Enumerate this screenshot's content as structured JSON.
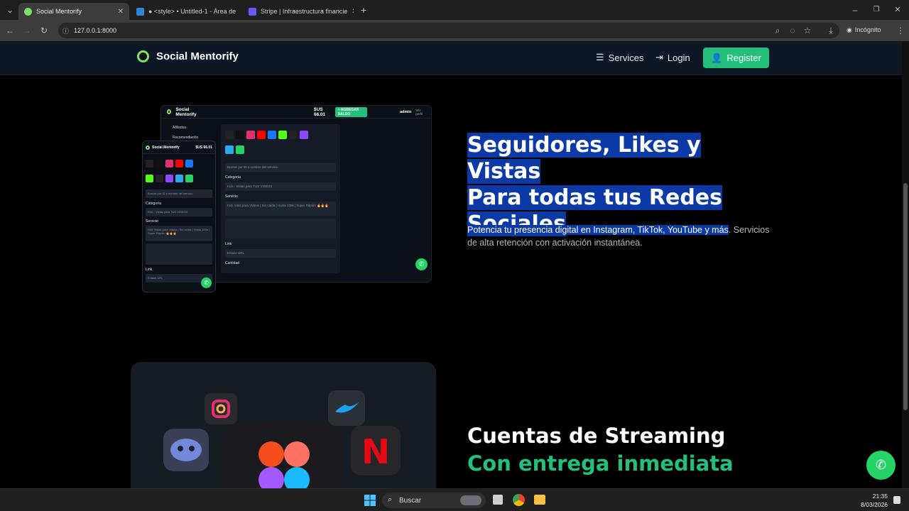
{
  "browser": {
    "tabs": [
      {
        "label": "Social Mentorify",
        "active": true
      },
      {
        "label": "● <style> • Untitled-1 - Área de",
        "active": false
      },
      {
        "label": "Stripe | Infraestructura financie",
        "active": false
      }
    ],
    "url": "127.0.0.1:8000",
    "incognito_label": "Incógnito"
  },
  "header": {
    "brand": "Social Mentorify",
    "nav": {
      "services": "Services",
      "login": "Login",
      "register": "Register"
    }
  },
  "hero": {
    "title_line1": "Seguidores, Likes y Vistas",
    "title_line2": "Para todas tus Redes",
    "title_line3": "Sociales",
    "desc_highlight": "Potencia tu presencia digital en Instagram, TikTok, YouTube y más",
    "desc_rest": ". Servicios de alta retención con activación instantánea."
  },
  "mockup": {
    "brand": "Social Mentorify",
    "balance": "$US 66.01",
    "add_balance": "+ AGREGAR SALDO",
    "user": "admin",
    "user_sub": "Ver perfil",
    "menu_1": "Afiliados",
    "menu_2": "Recomendación",
    "search_placeholder": "Buscar por ID o nombre del servicio",
    "category_label": "Categoría",
    "category_value": "Kick - Vistas para TUS VIDEOS",
    "service_label": "Servicio",
    "service_value": "Kick Vista para Videos | Sin caída | Hasta 100k | Super Rápido 🔥🔥🔥",
    "link_label": "Link",
    "link_placeholder": "Enlace URL",
    "quantity_label": "Cantidad",
    "phone_category_value": "Kick - Vistas para TUS VIDEOS",
    "phone_service_value": "Kick Vistas para videos | Sin caída | Hasta 100k | Super Rápido 🔥🔥🔥"
  },
  "streaming": {
    "title": "Cuentas de Streaming",
    "subtitle": "Con entrega inmediata"
  },
  "taskbar": {
    "search_label": "Buscar",
    "time": "21:35",
    "date": "8/03/2026"
  },
  "colors": {
    "accent": "#22c07a",
    "selection": "#0b3aa6",
    "header_bg": "#0e1726"
  }
}
